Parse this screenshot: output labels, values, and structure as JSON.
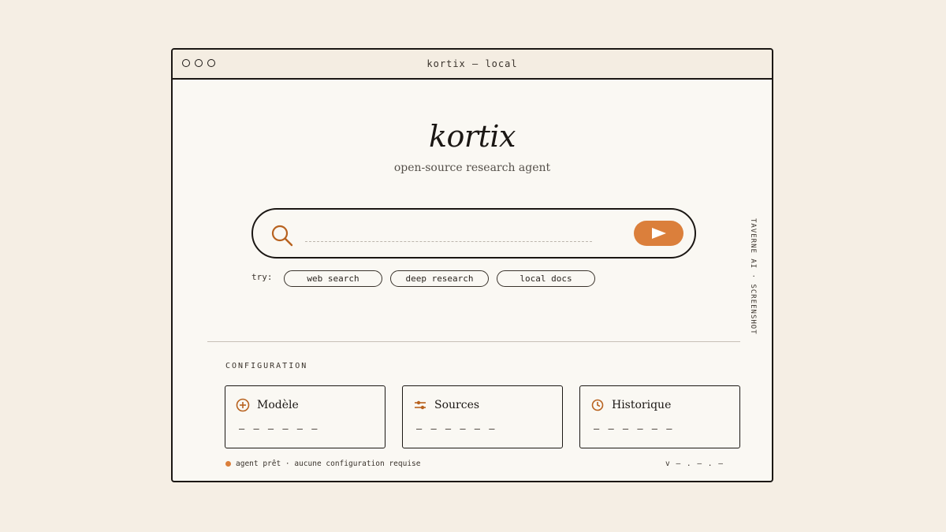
{
  "window": {
    "title": "kortix — local"
  },
  "brand": {
    "logo": "kortix",
    "tagline": "open-source research agent"
  },
  "search": {
    "placeholder": "",
    "value": ""
  },
  "suggestions": {
    "label": "try:",
    "chips": [
      "web search",
      "deep research",
      "local docs"
    ]
  },
  "side_label": "TAVERNE AI · SCREENSHOT",
  "config": {
    "title": "CONFIGURATION",
    "cards": [
      {
        "title": "Modèle",
        "value": "– – – – – –",
        "icon": "plus-circle-icon"
      },
      {
        "title": "Sources",
        "value": "– – – – – –",
        "icon": "sliders-icon"
      },
      {
        "title": "Historique",
        "value": "– – – – – –",
        "icon": "clock-icon"
      }
    ]
  },
  "status": {
    "text": "agent prêt · aucune configuration requise",
    "version": "v – . – . –"
  },
  "colors": {
    "accent": "#db7f3b",
    "background": "#f5eee4",
    "window": "#faf8f3",
    "ink": "#1b1714"
  }
}
